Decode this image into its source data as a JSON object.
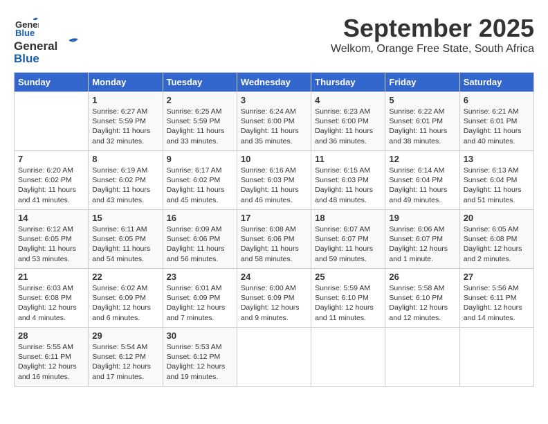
{
  "logo": {
    "line1": "General",
    "line2": "Blue"
  },
  "title": "September 2025",
  "subtitle": "Welkom, Orange Free State, South Africa",
  "days_header": [
    "Sunday",
    "Monday",
    "Tuesday",
    "Wednesday",
    "Thursday",
    "Friday",
    "Saturday"
  ],
  "weeks": [
    [
      {
        "num": "",
        "info": ""
      },
      {
        "num": "1",
        "info": "Sunrise: 6:27 AM\nSunset: 5:59 PM\nDaylight: 11 hours\nand 32 minutes."
      },
      {
        "num": "2",
        "info": "Sunrise: 6:25 AM\nSunset: 5:59 PM\nDaylight: 11 hours\nand 33 minutes."
      },
      {
        "num": "3",
        "info": "Sunrise: 6:24 AM\nSunset: 6:00 PM\nDaylight: 11 hours\nand 35 minutes."
      },
      {
        "num": "4",
        "info": "Sunrise: 6:23 AM\nSunset: 6:00 PM\nDaylight: 11 hours\nand 36 minutes."
      },
      {
        "num": "5",
        "info": "Sunrise: 6:22 AM\nSunset: 6:01 PM\nDaylight: 11 hours\nand 38 minutes."
      },
      {
        "num": "6",
        "info": "Sunrise: 6:21 AM\nSunset: 6:01 PM\nDaylight: 11 hours\nand 40 minutes."
      }
    ],
    [
      {
        "num": "7",
        "info": "Sunrise: 6:20 AM\nSunset: 6:02 PM\nDaylight: 11 hours\nand 41 minutes."
      },
      {
        "num": "8",
        "info": "Sunrise: 6:19 AM\nSunset: 6:02 PM\nDaylight: 11 hours\nand 43 minutes."
      },
      {
        "num": "9",
        "info": "Sunrise: 6:17 AM\nSunset: 6:02 PM\nDaylight: 11 hours\nand 45 minutes."
      },
      {
        "num": "10",
        "info": "Sunrise: 6:16 AM\nSunset: 6:03 PM\nDaylight: 11 hours\nand 46 minutes."
      },
      {
        "num": "11",
        "info": "Sunrise: 6:15 AM\nSunset: 6:03 PM\nDaylight: 11 hours\nand 48 minutes."
      },
      {
        "num": "12",
        "info": "Sunrise: 6:14 AM\nSunset: 6:04 PM\nDaylight: 11 hours\nand 49 minutes."
      },
      {
        "num": "13",
        "info": "Sunrise: 6:13 AM\nSunset: 6:04 PM\nDaylight: 11 hours\nand 51 minutes."
      }
    ],
    [
      {
        "num": "14",
        "info": "Sunrise: 6:12 AM\nSunset: 6:05 PM\nDaylight: 11 hours\nand 53 minutes."
      },
      {
        "num": "15",
        "info": "Sunrise: 6:11 AM\nSunset: 6:05 PM\nDaylight: 11 hours\nand 54 minutes."
      },
      {
        "num": "16",
        "info": "Sunrise: 6:09 AM\nSunset: 6:06 PM\nDaylight: 11 hours\nand 56 minutes."
      },
      {
        "num": "17",
        "info": "Sunrise: 6:08 AM\nSunset: 6:06 PM\nDaylight: 11 hours\nand 58 minutes."
      },
      {
        "num": "18",
        "info": "Sunrise: 6:07 AM\nSunset: 6:07 PM\nDaylight: 11 hours\nand 59 minutes."
      },
      {
        "num": "19",
        "info": "Sunrise: 6:06 AM\nSunset: 6:07 PM\nDaylight: 12 hours\nand 1 minute."
      },
      {
        "num": "20",
        "info": "Sunrise: 6:05 AM\nSunset: 6:08 PM\nDaylight: 12 hours\nand 2 minutes."
      }
    ],
    [
      {
        "num": "21",
        "info": "Sunrise: 6:03 AM\nSunset: 6:08 PM\nDaylight: 12 hours\nand 4 minutes."
      },
      {
        "num": "22",
        "info": "Sunrise: 6:02 AM\nSunset: 6:09 PM\nDaylight: 12 hours\nand 6 minutes."
      },
      {
        "num": "23",
        "info": "Sunrise: 6:01 AM\nSunset: 6:09 PM\nDaylight: 12 hours\nand 7 minutes."
      },
      {
        "num": "24",
        "info": "Sunrise: 6:00 AM\nSunset: 6:09 PM\nDaylight: 12 hours\nand 9 minutes."
      },
      {
        "num": "25",
        "info": "Sunrise: 5:59 AM\nSunset: 6:10 PM\nDaylight: 12 hours\nand 11 minutes."
      },
      {
        "num": "26",
        "info": "Sunrise: 5:58 AM\nSunset: 6:10 PM\nDaylight: 12 hours\nand 12 minutes."
      },
      {
        "num": "27",
        "info": "Sunrise: 5:56 AM\nSunset: 6:11 PM\nDaylight: 12 hours\nand 14 minutes."
      }
    ],
    [
      {
        "num": "28",
        "info": "Sunrise: 5:55 AM\nSunset: 6:11 PM\nDaylight: 12 hours\nand 16 minutes."
      },
      {
        "num": "29",
        "info": "Sunrise: 5:54 AM\nSunset: 6:12 PM\nDaylight: 12 hours\nand 17 minutes."
      },
      {
        "num": "30",
        "info": "Sunrise: 5:53 AM\nSunset: 6:12 PM\nDaylight: 12 hours\nand 19 minutes."
      },
      {
        "num": "",
        "info": ""
      },
      {
        "num": "",
        "info": ""
      },
      {
        "num": "",
        "info": ""
      },
      {
        "num": "",
        "info": ""
      }
    ]
  ]
}
